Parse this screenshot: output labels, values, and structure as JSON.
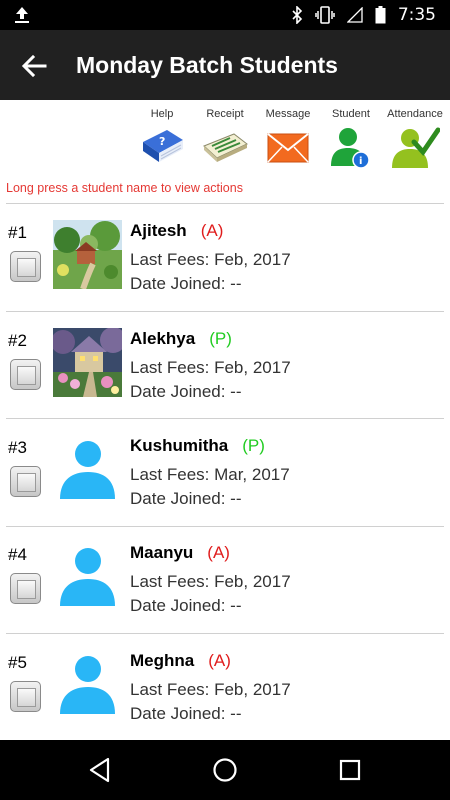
{
  "status_bar": {
    "time": "7:35",
    "icons": [
      "upload-icon",
      "bluetooth-icon",
      "vibrate-icon",
      "signal-icon",
      "battery-icon"
    ]
  },
  "toolbar": {
    "title": "Monday Batch Students",
    "back_icon": "arrow-back-icon"
  },
  "actions": [
    {
      "label": "Help",
      "icon": "help-book-icon"
    },
    {
      "label": "Receipt",
      "icon": "receipt-icon"
    },
    {
      "label": "Message",
      "icon": "envelope-icon"
    },
    {
      "label": "Student",
      "icon": "student-info-icon"
    },
    {
      "label": "Attendance",
      "icon": "attendance-check-icon"
    }
  ],
  "hint": "Long press a student name to view actions",
  "students": [
    {
      "number": "#1",
      "name": "Ajitesh",
      "status": "(A)",
      "fees": "Last Fees: Feb, 2017",
      "joined": "Date Joined: --",
      "photo": "landscape-painting-1"
    },
    {
      "number": "#2",
      "name": "Alekhya",
      "status": "(P)",
      "fees": "Last Fees: Feb, 2017",
      "joined": "Date Joined: --",
      "photo": "cottage-painting"
    },
    {
      "number": "#3",
      "name": "Kushumitha",
      "status": "(P)",
      "fees": "Last Fees: Mar, 2017",
      "joined": "Date Joined: --",
      "photo": "default-avatar"
    },
    {
      "number": "#4",
      "name": "Maanyu",
      "status": "(A)",
      "fees": "Last Fees: Feb, 2017",
      "joined": "Date Joined: --",
      "photo": "default-avatar"
    },
    {
      "number": "#5",
      "name": "Meghna",
      "status": "(A)",
      "fees": "Last Fees: Feb, 2017",
      "joined": "Date Joined: --",
      "photo": "default-avatar"
    }
  ],
  "colors": {
    "absent": "#e01d1d",
    "present": "#22cc22",
    "toolbar": "#212121",
    "hint": "#e53935",
    "avatar": "#29b6f6"
  },
  "nav_bar": {
    "icons": [
      "back-triangle-icon",
      "home-circle-icon",
      "recents-square-icon"
    ]
  }
}
